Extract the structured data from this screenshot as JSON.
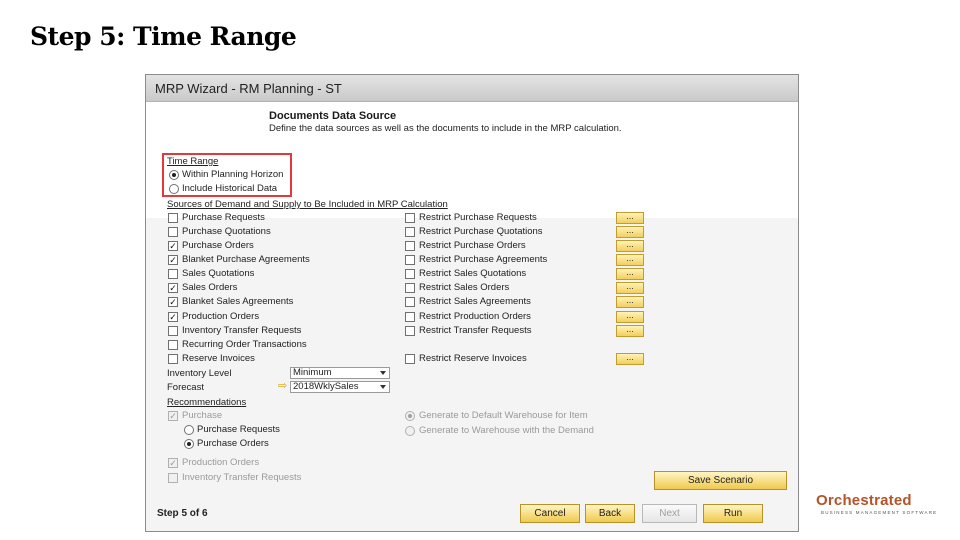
{
  "slide": {
    "title": "Step 5: Time Range"
  },
  "window": {
    "title": "MRP Wizard - RM Planning - ST"
  },
  "header": {
    "title": "Documents Data Source",
    "description": "Define the data sources as well as the documents to include in the MRP calculation."
  },
  "time_range": {
    "label": "Time Range",
    "options": [
      {
        "label": "Within Planning Horizon",
        "selected": true
      },
      {
        "label": "Include Historical Data",
        "selected": false
      }
    ]
  },
  "sources": {
    "label": "Sources of Demand and Supply to Be Included in MRP Calculation",
    "rows": [
      {
        "left": "Purchase Requests",
        "left_checked": false,
        "right": "Restrict Purchase Requests",
        "right_checked": false,
        "button": "..."
      },
      {
        "left": "Purchase Quotations",
        "left_checked": false,
        "right": "Restrict Purchase Quotations",
        "right_checked": false,
        "button": "..."
      },
      {
        "left": "Purchase Orders",
        "left_checked": true,
        "right": "Restrict Purchase Orders",
        "right_checked": false,
        "button": "..."
      },
      {
        "left": "Blanket Purchase Agreements",
        "left_checked": true,
        "right": "Restrict Purchase Agreements",
        "right_checked": false,
        "button": "..."
      },
      {
        "left": "Sales Quotations",
        "left_checked": false,
        "right": "Restrict Sales Quotations",
        "right_checked": false,
        "button": "..."
      },
      {
        "left": "Sales Orders",
        "left_checked": true,
        "right": "Restrict Sales Orders",
        "right_checked": false,
        "button": "..."
      },
      {
        "left": "Blanket Sales Agreements",
        "left_checked": true,
        "right": "Restrict Sales Agreements",
        "right_checked": false,
        "button": "..."
      },
      {
        "left": "Production Orders",
        "left_checked": true,
        "right": "Restrict Production Orders",
        "right_checked": false,
        "button": "..."
      },
      {
        "left": "Inventory Transfer Requests",
        "left_checked": false,
        "right": "Restrict Transfer Requests",
        "right_checked": false,
        "button": "..."
      },
      {
        "left": "Recurring Order Transactions",
        "left_checked": false
      },
      {
        "left": "Reserve Invoices",
        "left_checked": false,
        "right": "Restrict Reserve Invoices",
        "right_checked": false,
        "button": "..."
      }
    ]
  },
  "inventory_level": {
    "label": "Inventory Level",
    "value": "Minimum"
  },
  "forecast": {
    "label": "Forecast",
    "value": "2018WklySales"
  },
  "recommendations": {
    "label": "Recommendations",
    "purchase": {
      "label": "Purchase",
      "checked": true
    },
    "purchase_options": [
      {
        "label": "Purchase Requests",
        "selected": false
      },
      {
        "label": "Purchase Orders",
        "selected": true
      }
    ],
    "warehouse_options": [
      {
        "label": "Generate to Default Warehouse for Item",
        "selected": true
      },
      {
        "label": "Generate to Warehouse with the Demand",
        "selected": false
      }
    ],
    "production_orders": {
      "label": "Production Orders",
      "checked": true
    },
    "inventory_transfer_requests": {
      "label": "Inventory Transfer Requests",
      "checked": false
    }
  },
  "footer": {
    "step": "Step 5 of 6",
    "save_scenario": "Save Scenario",
    "cancel": "Cancel",
    "back": "Back",
    "next": "Next",
    "run": "Run"
  },
  "logo": {
    "name": "Orchestrated",
    "tagline": "BUSINESS MANAGEMENT SOFTWARE"
  },
  "colors": {
    "highlight": "#e03a3a",
    "button": "#f0c94e",
    "logo": "#b5532a"
  }
}
